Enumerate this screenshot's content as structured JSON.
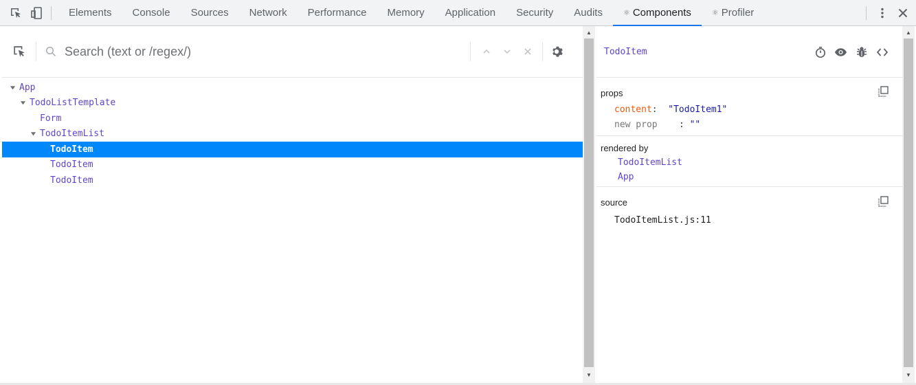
{
  "toolbar": {
    "tabs": [
      {
        "label": "Elements"
      },
      {
        "label": "Console"
      },
      {
        "label": "Sources"
      },
      {
        "label": "Network"
      },
      {
        "label": "Performance"
      },
      {
        "label": "Memory"
      },
      {
        "label": "Application"
      },
      {
        "label": "Security"
      },
      {
        "label": "Audits"
      },
      {
        "label": "Components",
        "prefix": "⚛",
        "active": true
      },
      {
        "label": "Profiler",
        "prefix": "⚛"
      }
    ]
  },
  "search": {
    "placeholder": "Search (text or /regex/)",
    "value": ""
  },
  "tree": {
    "nodes": [
      {
        "label": "App",
        "expanded": true
      },
      {
        "label": "TodoListTemplate",
        "expanded": true
      },
      {
        "label": "Form"
      },
      {
        "label": "TodoItemList",
        "expanded": true
      },
      {
        "label": "TodoItem",
        "selected": true
      },
      {
        "label": "TodoItem"
      },
      {
        "label": "TodoItem"
      }
    ]
  },
  "inspector": {
    "component_name": "TodoItem",
    "props": {
      "title": "props",
      "items": [
        {
          "key": "content",
          "colon": ":",
          "value": "\"TodoItem1\""
        },
        {
          "key": "new prop",
          "colon": ":",
          "value": "\"\""
        }
      ]
    },
    "rendered_by": {
      "title": "rendered by",
      "items": [
        "TodoItemList",
        "App"
      ]
    },
    "source": {
      "title": "source",
      "file": "TodoItemList.js:11"
    }
  },
  "colors": {
    "selection": "#0088fa",
    "component": "#6244c8",
    "prop_key": "#e8590c",
    "tab_indicator": "#1a73e8"
  }
}
